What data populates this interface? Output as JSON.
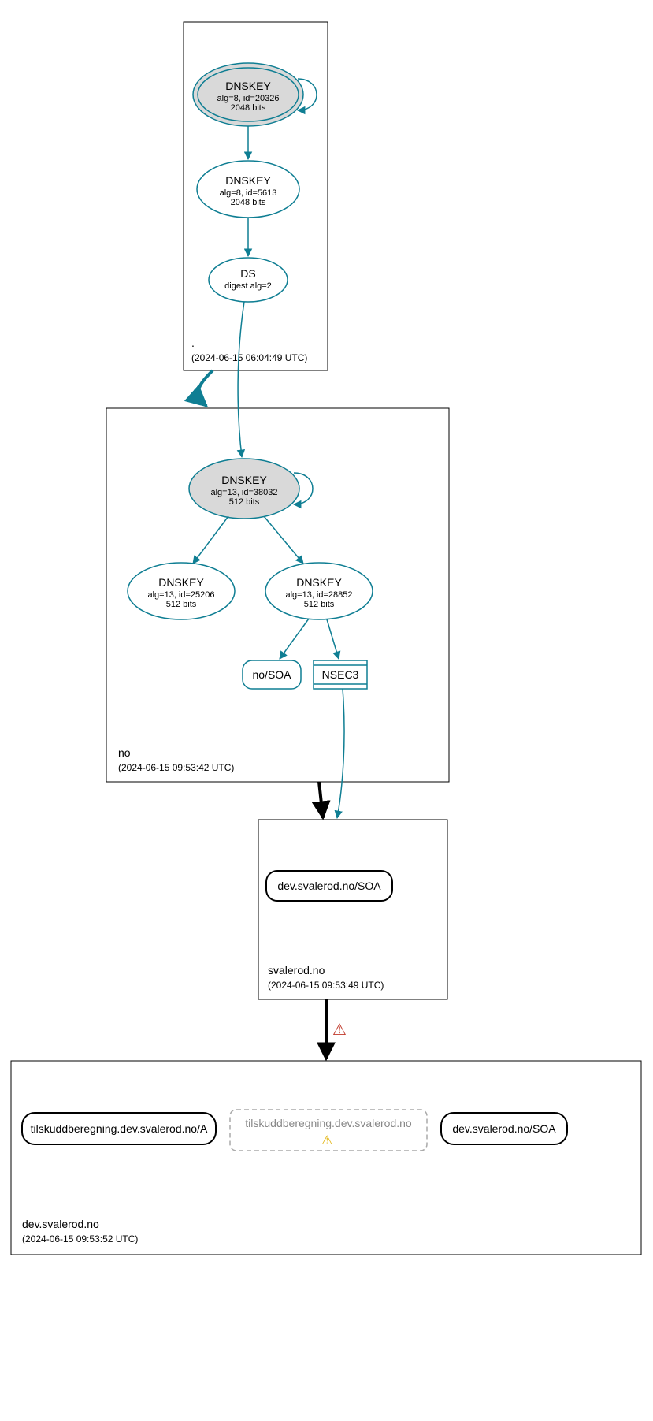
{
  "zones": {
    "root": {
      "label": ".",
      "time": "(2024-06-15 06:04:49 UTC)"
    },
    "no": {
      "label": "no",
      "time": "(2024-06-15 09:53:42 UTC)"
    },
    "sval": {
      "label": "svalerod.no",
      "time": "(2024-06-15 09:53:49 UTC)"
    },
    "dev": {
      "label": "dev.svalerod.no",
      "time": "(2024-06-15 09:53:52 UTC)"
    }
  },
  "nodes": {
    "root_ksk": {
      "t": "DNSKEY",
      "s1": "alg=8, id=20326",
      "s2": "2048 bits"
    },
    "root_zsk": {
      "t": "DNSKEY",
      "s1": "alg=8, id=5613",
      "s2": "2048 bits"
    },
    "root_ds": {
      "t": "DS",
      "s1": "digest alg=2"
    },
    "no_ksk": {
      "t": "DNSKEY",
      "s1": "alg=13, id=38032",
      "s2": "512 bits"
    },
    "no_z1": {
      "t": "DNSKEY",
      "s1": "alg=13, id=25206",
      "s2": "512 bits"
    },
    "no_z2": {
      "t": "DNSKEY",
      "s1": "alg=13, id=28852",
      "s2": "512 bits"
    },
    "no_soa": {
      "t": "no/SOA"
    },
    "nsec3": {
      "t": "NSEC3"
    },
    "sval_soa": {
      "t": "dev.svalerod.no/SOA"
    },
    "dev_a": {
      "t": "tilskuddberegning.dev.svalerod.no/A"
    },
    "dev_warn": {
      "t": "tilskuddberegning.dev.svalerod.no"
    },
    "dev_soa": {
      "t": "dev.svalerod.no/SOA"
    }
  },
  "icons": {
    "warn_red": "⚠",
    "warn_yel": "⚠"
  }
}
